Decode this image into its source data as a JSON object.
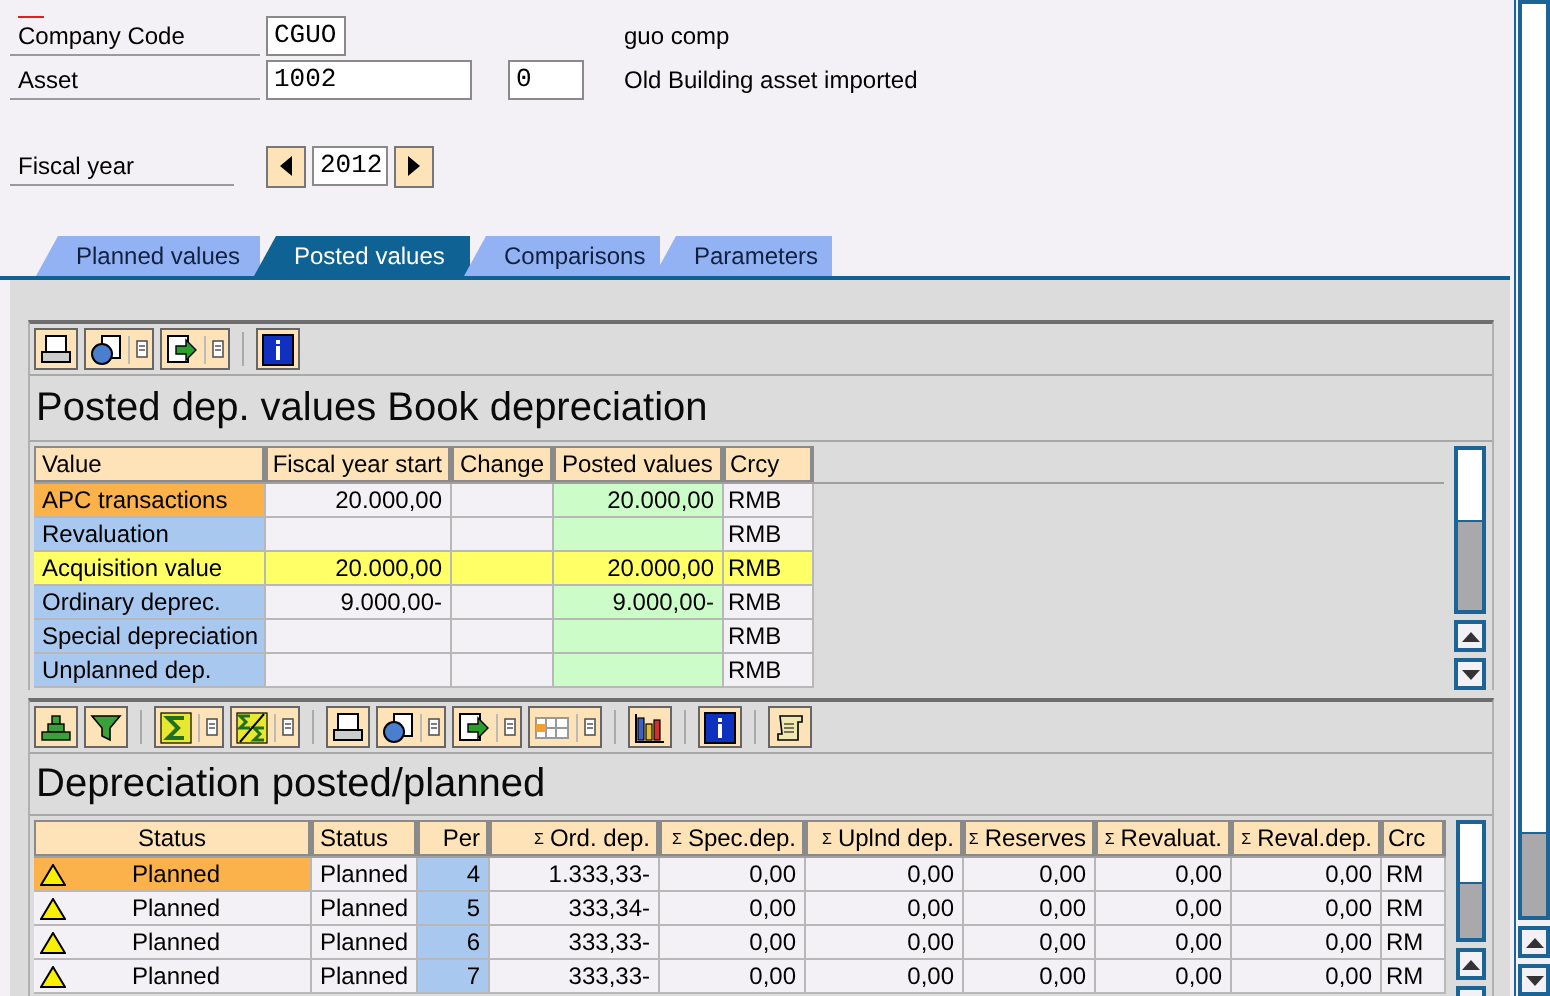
{
  "company_code": {
    "label": "Company Code",
    "value": "CGUO",
    "description": "guo comp"
  },
  "asset": {
    "label": "Asset",
    "value": "1002",
    "sub_number": "0",
    "description": "Old Building asset imported"
  },
  "fiscal_year": {
    "label": "Fiscal year",
    "value": "2012"
  },
  "tabs": [
    {
      "label": "Planned values",
      "selected": false
    },
    {
      "label": "Posted values",
      "selected": true
    },
    {
      "label": "Comparisons",
      "selected": false
    },
    {
      "label": "Parameters",
      "selected": false
    }
  ],
  "values_panel": {
    "title": "Posted dep. values Book depreciation",
    "columns": [
      {
        "label": "Value",
        "kind": "key"
      },
      {
        "label": "Fiscal year start",
        "kind": "number"
      },
      {
        "label": "Change",
        "kind": "number"
      },
      {
        "label": "Posted values",
        "kind": "posted"
      },
      {
        "label": "Crcy",
        "kind": "text"
      }
    ],
    "rows": [
      {
        "cells": [
          "APC transactions",
          "20.000,00",
          "",
          "20.000,00",
          "RMB"
        ],
        "selected": true,
        "highlighted": false
      },
      {
        "cells": [
          "Revaluation",
          "",
          "",
          "",
          "RMB"
        ],
        "selected": false,
        "highlighted": false
      },
      {
        "cells": [
          "Acquisition value",
          "20.000,00",
          "",
          "20.000,00",
          "RMB"
        ],
        "selected": false,
        "highlighted": true
      },
      {
        "cells": [
          "Ordinary deprec.",
          "9.000,00-",
          "",
          "9.000,00-",
          "RMB"
        ],
        "selected": false,
        "highlighted": false
      },
      {
        "cells": [
          "Special depreciation",
          "",
          "",
          "",
          "RMB"
        ],
        "selected": false,
        "highlighted": false
      },
      {
        "cells": [
          "Unplanned dep.",
          "",
          "",
          "",
          "RMB"
        ],
        "selected": false,
        "highlighted": false
      }
    ]
  },
  "depreciation_panel": {
    "title": "Depreciation posted/planned",
    "columns": [
      {
        "label": "Status",
        "kind": "status"
      },
      {
        "label": "Status",
        "kind": "text"
      },
      {
        "label": "Per",
        "kind": "key_number"
      },
      {
        "label": "Ord. dep.",
        "kind": "number",
        "sum_mark": "Σ"
      },
      {
        "label": "Spec.dep.",
        "kind": "number",
        "sum_mark": "Σ"
      },
      {
        "label": "Uplnd dep.",
        "kind": "number",
        "sum_mark": "Σ"
      },
      {
        "label": "Reserves",
        "kind": "number",
        "sum_mark": "Σ"
      },
      {
        "label": "Revaluat.",
        "kind": "number",
        "sum_mark": "Σ"
      },
      {
        "label": "Reval.dep.",
        "kind": "number",
        "sum_mark": "Σ"
      },
      {
        "label": "Crc",
        "kind": "text"
      }
    ],
    "rows": [
      {
        "warning": true,
        "cells": [
          "Planned",
          "Planned",
          "4",
          "1.333,33-",
          "0,00",
          "0,00",
          "0,00",
          "0,00",
          "0,00",
          "RM"
        ],
        "selected": true,
        "highlighted": false
      },
      {
        "warning": true,
        "cells": [
          "Planned",
          "Planned",
          "5",
          "333,34-",
          "0,00",
          "0,00",
          "0,00",
          "0,00",
          "0,00",
          "RM"
        ],
        "selected": false,
        "highlighted": false
      },
      {
        "warning": true,
        "cells": [
          "Planned",
          "Planned",
          "6",
          "333,33-",
          "0,00",
          "0,00",
          "0,00",
          "0,00",
          "0,00",
          "RM"
        ],
        "selected": false,
        "highlighted": false
      },
      {
        "warning": true,
        "cells": [
          "Planned",
          "Planned",
          "7",
          "333,33-",
          "0,00",
          "0,00",
          "0,00",
          "0,00",
          "0,00",
          "RM"
        ],
        "selected": false,
        "highlighted": false
      }
    ]
  }
}
